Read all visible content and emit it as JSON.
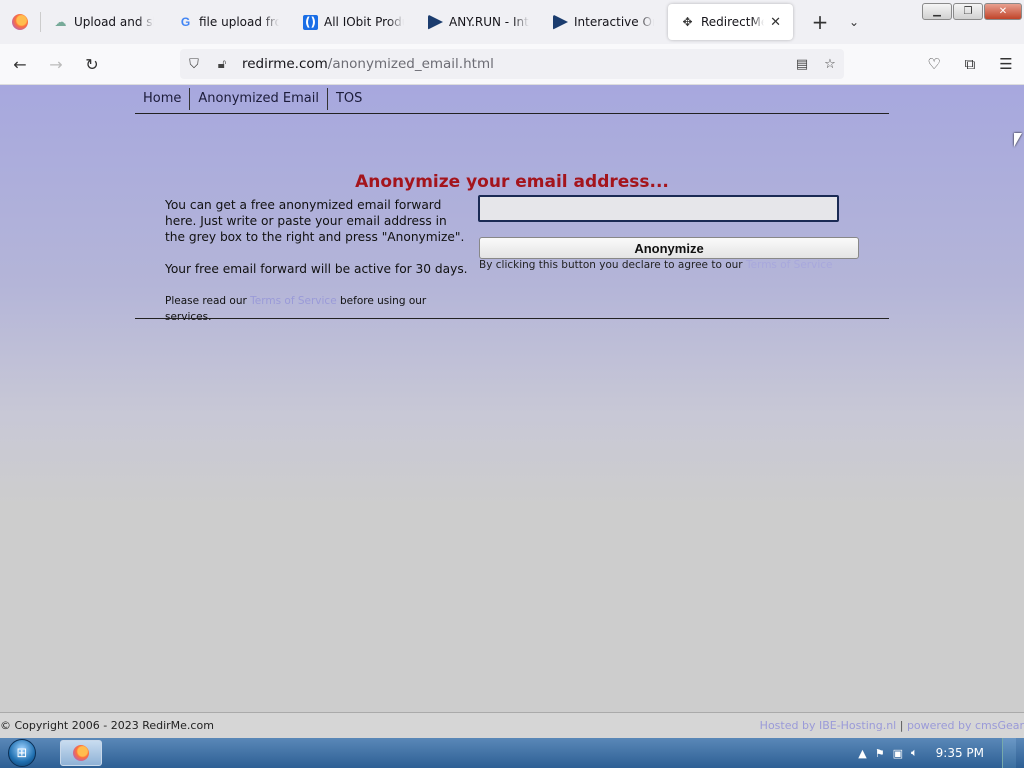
{
  "browser": {
    "tabs": [
      {
        "label": "Upload and sha",
        "icon": "cloud-icon"
      },
      {
        "label": "file upload from",
        "icon": "google-icon"
      },
      {
        "label": "All IObit Produc",
        "icon": "iobit-icon"
      },
      {
        "label": "ANY.RUN - Inte",
        "icon": "anyrun-icon"
      },
      {
        "label": "Interactive Onli",
        "icon": "anyrun-icon"
      },
      {
        "label": "RedirectMe -",
        "icon": "move-icon",
        "active": true
      }
    ],
    "url_domain": "redirme.com",
    "url_path": "/anonymized_email.html"
  },
  "site": {
    "nav": [
      "Home",
      "Anonymized Email",
      "TOS"
    ],
    "heading": "Anonymize your email address...",
    "intro": "You can get a free anonymized email forward here. Just write or paste your email address in the grey box to the right and press \"Anonymize\".",
    "active_days": "Your free email forward will be active for 30 days.",
    "read_prefix": "Please read our ",
    "read_link": "Terms of Service",
    "read_suffix": " before using our services.",
    "email_value": "",
    "button_label": "Anonymize",
    "declare_text": "By clicking this button you declare to agree to our ",
    "declare_link": "Terms of Service"
  },
  "footer": {
    "copyright": "© Copyright 2006 - 2023 RedirMe.com",
    "hosted": "Hosted by IBE-Hosting.nl",
    "powered": "powered by cmsGear"
  },
  "taskbar": {
    "clock": "9:35 PM"
  }
}
